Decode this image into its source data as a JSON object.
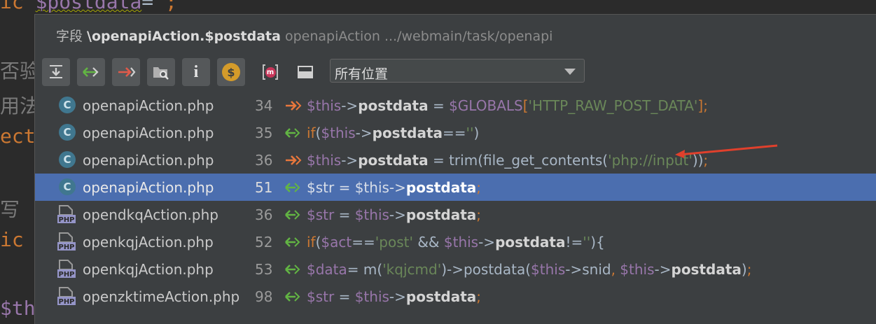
{
  "background_code": {
    "top_keyword": "ic",
    "top_var": "$postdata",
    "top_eq": "=",
    "top_tail": "  ;",
    "left_lines": [
      "否验",
      "用法",
      "ect",
      "写",
      "ic",
      "$th"
    ]
  },
  "popup": {
    "title_prefix": "字段 ",
    "title_bold": "\\openapiAction.$postdata",
    "title_location": "openapiAction .../webmain/task/openapi"
  },
  "toolbar": {
    "scope_value": "所有位置",
    "buttons": [
      "expand-all-icon",
      "read-usage-icon",
      "write-usage-icon",
      "folder-search-icon",
      "info-icon",
      "dollar-icon",
      "merge-icon",
      "preview-icon"
    ],
    "info_glyph": "i",
    "dollar_glyph": "$",
    "m_glyph": "m"
  },
  "usages": [
    {
      "type": "class",
      "file": "openapiAction.php",
      "line": "34",
      "access": "write",
      "selected": false,
      "code": [
        [
          "v",
          "$this"
        ],
        [
          "p",
          "->"
        ],
        [
          "b",
          "postdata"
        ],
        [
          "p",
          " = "
        ],
        [
          "v",
          "$GLOBALS"
        ],
        [
          "k",
          "["
        ],
        [
          "s",
          "'HTTP_RAW_POST_DATA'"
        ],
        [
          "k",
          "]"
        ],
        [
          "k",
          ";"
        ]
      ]
    },
    {
      "type": "class",
      "file": "openapiAction.php",
      "line": "35",
      "access": "read",
      "selected": false,
      "code": [
        [
          "k",
          "if"
        ],
        [
          "p",
          "("
        ],
        [
          "v",
          "$this"
        ],
        [
          "p",
          "->"
        ],
        [
          "b",
          "postdata"
        ],
        [
          "p",
          "=="
        ],
        [
          "s",
          "''"
        ],
        [
          "p",
          ")"
        ]
      ]
    },
    {
      "type": "class",
      "file": "openapiAction.php",
      "line": "36",
      "access": "write",
      "selected": false,
      "code": [
        [
          "v",
          "$this"
        ],
        [
          "p",
          "->"
        ],
        [
          "b",
          "postdata"
        ],
        [
          "p",
          " = trim(file_get_contents("
        ],
        [
          "s",
          "'php://input'"
        ],
        [
          "p",
          "))"
        ],
        [
          "k",
          ";"
        ]
      ]
    },
    {
      "type": "class",
      "file": "openapiAction.php",
      "line": "51",
      "access": "read",
      "selected": true,
      "code": [
        [
          "v",
          "$str"
        ],
        [
          "p",
          " = "
        ],
        [
          "v",
          "$this"
        ],
        [
          "p",
          "->"
        ],
        [
          "b",
          "postdata"
        ],
        [
          "k",
          ";"
        ]
      ]
    },
    {
      "type": "php",
      "file": "opendkqAction.php",
      "line": "36",
      "access": "read",
      "selected": false,
      "code": [
        [
          "v",
          "$str"
        ],
        [
          "p",
          " = "
        ],
        [
          "v",
          "$this"
        ],
        [
          "p",
          "->"
        ],
        [
          "b",
          "postdata"
        ],
        [
          "k",
          ";"
        ]
      ]
    },
    {
      "type": "php",
      "file": "openkqjAction.php",
      "line": "52",
      "access": "read",
      "selected": false,
      "code": [
        [
          "k",
          "if"
        ],
        [
          "p",
          "("
        ],
        [
          "v",
          "$act"
        ],
        [
          "p",
          "=="
        ],
        [
          "s",
          "'post'"
        ],
        [
          "p",
          " && "
        ],
        [
          "v",
          "$this"
        ],
        [
          "p",
          "->"
        ],
        [
          "b",
          "postdata"
        ],
        [
          "p",
          "!="
        ],
        [
          "s",
          "''"
        ],
        [
          "p",
          "){"
        ]
      ]
    },
    {
      "type": "php",
      "file": "openkqjAction.php",
      "line": "53",
      "access": "read",
      "selected": false,
      "code": [
        [
          "v",
          "$data"
        ],
        [
          "p",
          "= m("
        ],
        [
          "s",
          "'kqjcmd'"
        ],
        [
          "p",
          ")->postdata("
        ],
        [
          "v",
          "$this"
        ],
        [
          "p",
          "->snid"
        ],
        [
          "k",
          ", "
        ],
        [
          "v",
          "$this"
        ],
        [
          "p",
          "->"
        ],
        [
          "b",
          "postdata"
        ],
        [
          "p",
          ")"
        ],
        [
          "k",
          ";"
        ]
      ]
    },
    {
      "type": "php",
      "file": "openzktimeAction.php",
      "line": "98",
      "access": "read",
      "selected": false,
      "code": [
        [
          "v",
          "$str"
        ],
        [
          "p",
          " = "
        ],
        [
          "v",
          "$this"
        ],
        [
          "p",
          "->"
        ],
        [
          "b",
          "postdata"
        ],
        [
          "k",
          ";"
        ]
      ]
    }
  ],
  "colors": {
    "popup_bg": "#3c3f41",
    "selection": "#4b6eaf",
    "write_arrow": "#e8773c",
    "read_arrow": "#62b543",
    "annotation_arrow": "#e0402c"
  },
  "class_icon_glyph": "C",
  "php_icon_text": "PHP"
}
